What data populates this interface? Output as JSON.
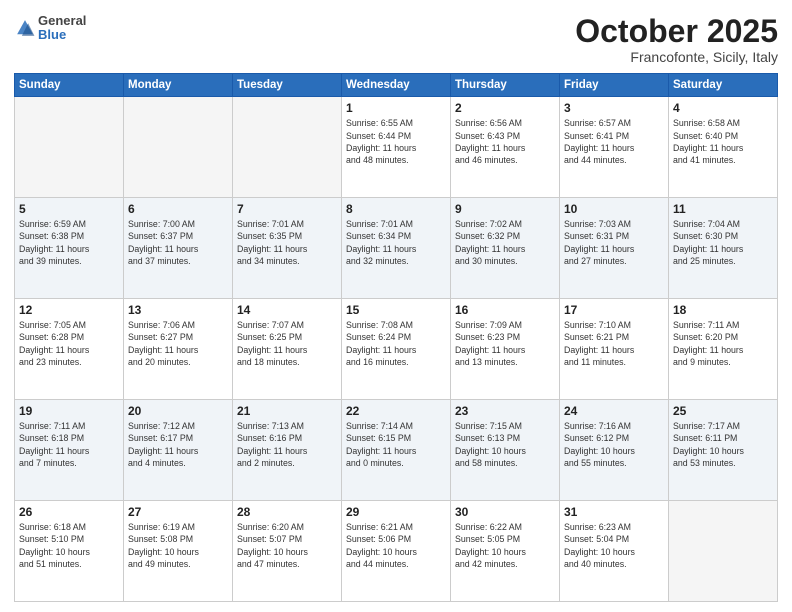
{
  "header": {
    "logo_general": "General",
    "logo_blue": "Blue",
    "month": "October 2025",
    "location": "Francofonte, Sicily, Italy"
  },
  "weekdays": [
    "Sunday",
    "Monday",
    "Tuesday",
    "Wednesday",
    "Thursday",
    "Friday",
    "Saturday"
  ],
  "weeks": [
    [
      {
        "day": "",
        "info": ""
      },
      {
        "day": "",
        "info": ""
      },
      {
        "day": "",
        "info": ""
      },
      {
        "day": "1",
        "info": "Sunrise: 6:55 AM\nSunset: 6:44 PM\nDaylight: 11 hours\nand 48 minutes."
      },
      {
        "day": "2",
        "info": "Sunrise: 6:56 AM\nSunset: 6:43 PM\nDaylight: 11 hours\nand 46 minutes."
      },
      {
        "day": "3",
        "info": "Sunrise: 6:57 AM\nSunset: 6:41 PM\nDaylight: 11 hours\nand 44 minutes."
      },
      {
        "day": "4",
        "info": "Sunrise: 6:58 AM\nSunset: 6:40 PM\nDaylight: 11 hours\nand 41 minutes."
      }
    ],
    [
      {
        "day": "5",
        "info": "Sunrise: 6:59 AM\nSunset: 6:38 PM\nDaylight: 11 hours\nand 39 minutes."
      },
      {
        "day": "6",
        "info": "Sunrise: 7:00 AM\nSunset: 6:37 PM\nDaylight: 11 hours\nand 37 minutes."
      },
      {
        "day": "7",
        "info": "Sunrise: 7:01 AM\nSunset: 6:35 PM\nDaylight: 11 hours\nand 34 minutes."
      },
      {
        "day": "8",
        "info": "Sunrise: 7:01 AM\nSunset: 6:34 PM\nDaylight: 11 hours\nand 32 minutes."
      },
      {
        "day": "9",
        "info": "Sunrise: 7:02 AM\nSunset: 6:32 PM\nDaylight: 11 hours\nand 30 minutes."
      },
      {
        "day": "10",
        "info": "Sunrise: 7:03 AM\nSunset: 6:31 PM\nDaylight: 11 hours\nand 27 minutes."
      },
      {
        "day": "11",
        "info": "Sunrise: 7:04 AM\nSunset: 6:30 PM\nDaylight: 11 hours\nand 25 minutes."
      }
    ],
    [
      {
        "day": "12",
        "info": "Sunrise: 7:05 AM\nSunset: 6:28 PM\nDaylight: 11 hours\nand 23 minutes."
      },
      {
        "day": "13",
        "info": "Sunrise: 7:06 AM\nSunset: 6:27 PM\nDaylight: 11 hours\nand 20 minutes."
      },
      {
        "day": "14",
        "info": "Sunrise: 7:07 AM\nSunset: 6:25 PM\nDaylight: 11 hours\nand 18 minutes."
      },
      {
        "day": "15",
        "info": "Sunrise: 7:08 AM\nSunset: 6:24 PM\nDaylight: 11 hours\nand 16 minutes."
      },
      {
        "day": "16",
        "info": "Sunrise: 7:09 AM\nSunset: 6:23 PM\nDaylight: 11 hours\nand 13 minutes."
      },
      {
        "day": "17",
        "info": "Sunrise: 7:10 AM\nSunset: 6:21 PM\nDaylight: 11 hours\nand 11 minutes."
      },
      {
        "day": "18",
        "info": "Sunrise: 7:11 AM\nSunset: 6:20 PM\nDaylight: 11 hours\nand 9 minutes."
      }
    ],
    [
      {
        "day": "19",
        "info": "Sunrise: 7:11 AM\nSunset: 6:18 PM\nDaylight: 11 hours\nand 7 minutes."
      },
      {
        "day": "20",
        "info": "Sunrise: 7:12 AM\nSunset: 6:17 PM\nDaylight: 11 hours\nand 4 minutes."
      },
      {
        "day": "21",
        "info": "Sunrise: 7:13 AM\nSunset: 6:16 PM\nDaylight: 11 hours\nand 2 minutes."
      },
      {
        "day": "22",
        "info": "Sunrise: 7:14 AM\nSunset: 6:15 PM\nDaylight: 11 hours\nand 0 minutes."
      },
      {
        "day": "23",
        "info": "Sunrise: 7:15 AM\nSunset: 6:13 PM\nDaylight: 10 hours\nand 58 minutes."
      },
      {
        "day": "24",
        "info": "Sunrise: 7:16 AM\nSunset: 6:12 PM\nDaylight: 10 hours\nand 55 minutes."
      },
      {
        "day": "25",
        "info": "Sunrise: 7:17 AM\nSunset: 6:11 PM\nDaylight: 10 hours\nand 53 minutes."
      }
    ],
    [
      {
        "day": "26",
        "info": "Sunrise: 6:18 AM\nSunset: 5:10 PM\nDaylight: 10 hours\nand 51 minutes."
      },
      {
        "day": "27",
        "info": "Sunrise: 6:19 AM\nSunset: 5:08 PM\nDaylight: 10 hours\nand 49 minutes."
      },
      {
        "day": "28",
        "info": "Sunrise: 6:20 AM\nSunset: 5:07 PM\nDaylight: 10 hours\nand 47 minutes."
      },
      {
        "day": "29",
        "info": "Sunrise: 6:21 AM\nSunset: 5:06 PM\nDaylight: 10 hours\nand 44 minutes."
      },
      {
        "day": "30",
        "info": "Sunrise: 6:22 AM\nSunset: 5:05 PM\nDaylight: 10 hours\nand 42 minutes."
      },
      {
        "day": "31",
        "info": "Sunrise: 6:23 AM\nSunset: 5:04 PM\nDaylight: 10 hours\nand 40 minutes."
      },
      {
        "day": "",
        "info": ""
      }
    ]
  ]
}
